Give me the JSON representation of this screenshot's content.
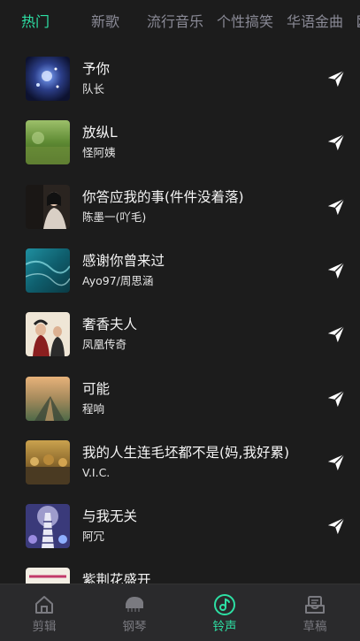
{
  "tabs": [
    {
      "label": "热门",
      "active": true
    },
    {
      "label": "新歌",
      "active": false
    },
    {
      "label": "流行音乐",
      "active": false
    },
    {
      "label": "个性搞笑",
      "active": false
    },
    {
      "label": "华语金曲",
      "active": false
    },
    {
      "label": "欧",
      "active": false
    }
  ],
  "songs": [
    {
      "title": "予你",
      "artist": "队长"
    },
    {
      "title": "放纵L",
      "artist": "怪阿姨"
    },
    {
      "title": "你答应我的事(件件没着落)",
      "artist": "陈墨一(吖毛)"
    },
    {
      "title": "感谢你曾来过",
      "artist": "Ayo97/周思涵"
    },
    {
      "title": "奢香夫人",
      "artist": "凤凰传奇"
    },
    {
      "title": "可能",
      "artist": "程响"
    },
    {
      "title": "我的人生连毛坯都不是(妈,我好累)",
      "artist": "V.I.C."
    },
    {
      "title": "与我无关",
      "artist": "阿冗"
    },
    {
      "title": "紫荆花盛开",
      "artist": ""
    }
  ],
  "nav": [
    {
      "label": "剪辑",
      "icon": "home-icon",
      "active": false
    },
    {
      "label": "钢琴",
      "icon": "piano-icon",
      "active": false
    },
    {
      "label": "铃声",
      "icon": "music-note-icon",
      "active": true
    },
    {
      "label": "草稿",
      "icon": "drafts-icon",
      "active": false
    }
  ],
  "colors": {
    "accent": "#2de0a4",
    "background": "#1c1c1c",
    "nav_background": "#2a2a2c"
  }
}
